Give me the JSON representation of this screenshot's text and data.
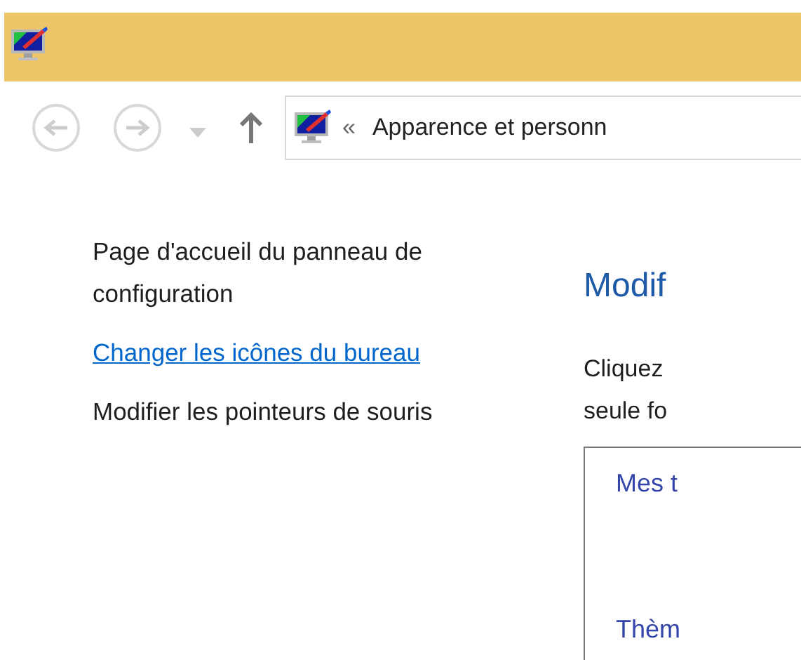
{
  "navigation": {
    "back": {
      "disabled": true
    },
    "forward": {
      "disabled": true
    },
    "address": {
      "separator": "«",
      "path": "Apparence et personn"
    }
  },
  "sidebar": {
    "items": [
      {
        "label": "Page d'accueil du panneau de configuration",
        "kind": "plain"
      },
      {
        "label": "Changer les icônes du bureau",
        "kind": "link"
      },
      {
        "label": "Modifier les pointeurs de souris",
        "kind": "plain"
      }
    ]
  },
  "main": {
    "heading": "Modif",
    "description_lines": [
      "Cliquez",
      "seule fo"
    ],
    "list_items": [
      "Mes t",
      "Thèm"
    ]
  }
}
